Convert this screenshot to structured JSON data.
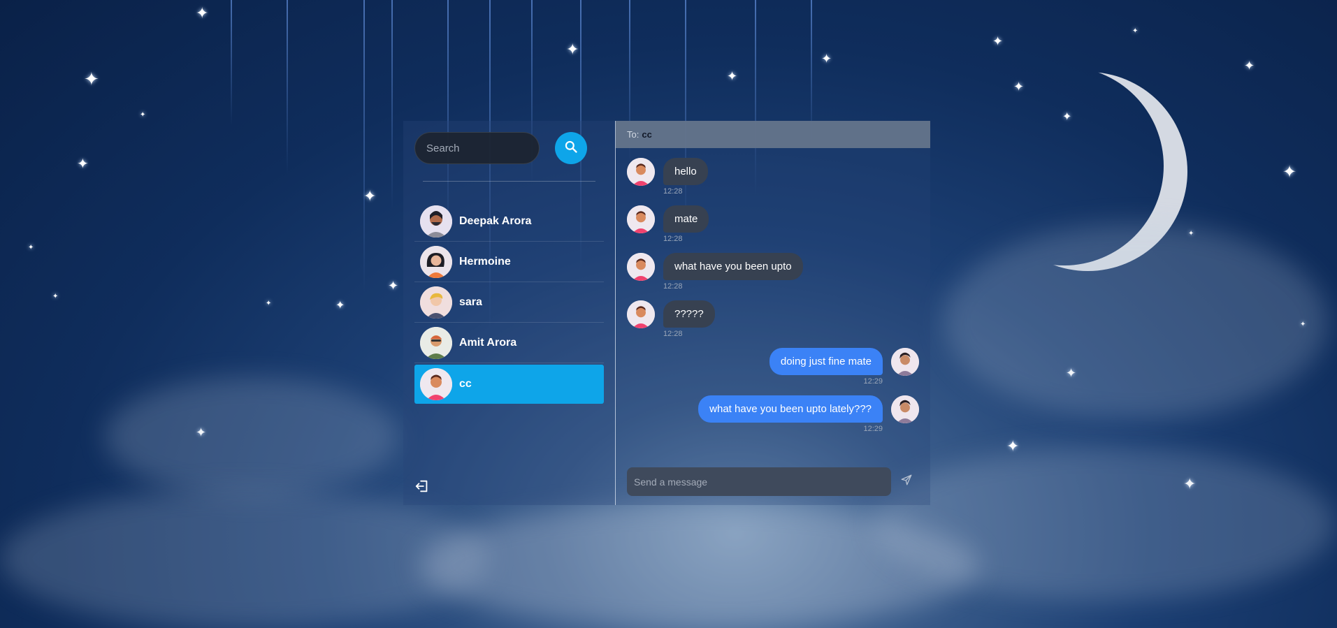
{
  "search": {
    "placeholder": "Search",
    "icon": "search-icon"
  },
  "contacts": [
    {
      "name": "Deepak Arora",
      "selected": false
    },
    {
      "name": "Hermoine",
      "selected": false
    },
    {
      "name": "sara",
      "selected": false
    },
    {
      "name": "Amit Arora",
      "selected": false
    },
    {
      "name": "cc",
      "selected": true
    }
  ],
  "sidebar": {
    "logout_icon": "logout-icon"
  },
  "conversation": {
    "to_label": "To:",
    "to_name": "cc",
    "messages": [
      {
        "direction": "in",
        "text": "hello",
        "time": "12:28"
      },
      {
        "direction": "in",
        "text": "mate",
        "time": "12:28"
      },
      {
        "direction": "in",
        "text": "what have you been upto",
        "time": "12:28"
      },
      {
        "direction": "in",
        "text": "?????",
        "time": "12:28"
      },
      {
        "direction": "out",
        "text": "doing just fine mate",
        "time": "12:29"
      },
      {
        "direction": "out",
        "text": "what have you been upto lately???",
        "time": "12:29"
      }
    ],
    "input_placeholder": "Send a message",
    "send_icon": "send-icon"
  },
  "colors": {
    "accent": "#0ea5e9",
    "outgoing_bubble": "#3b82f6",
    "incoming_bubble": "#374151"
  }
}
